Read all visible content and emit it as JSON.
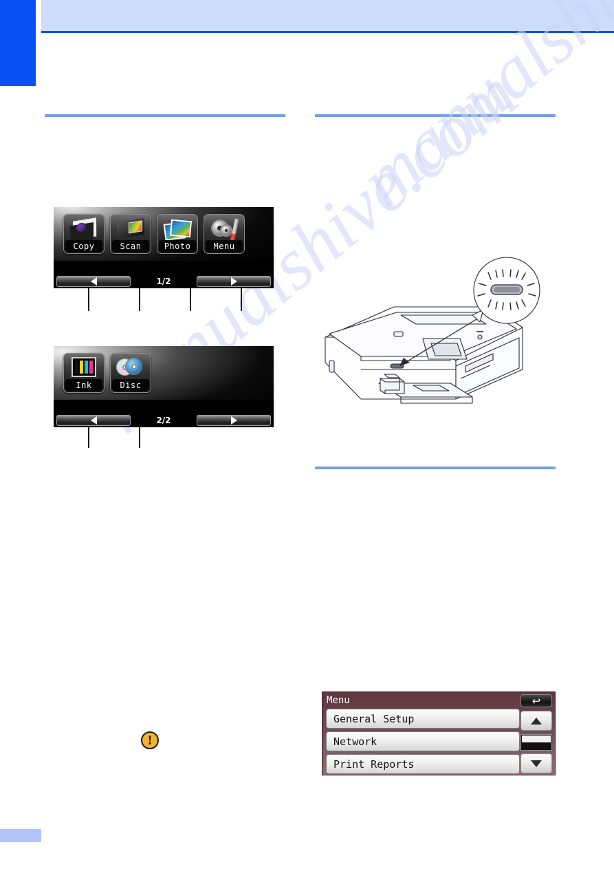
{
  "page": {
    "header_band_color": "#ccdcfa",
    "header_rule_color": "#0b50f5",
    "chapter_tab_color": "#0b50f5",
    "section_rule_color": "#77a0e0",
    "watermark_text": "manualshive.com"
  },
  "lcd_home_1": {
    "page_indicator": "1/2",
    "tiles": [
      {
        "label": "Copy",
        "icon": "copy-icon"
      },
      {
        "label": "Scan",
        "icon": "scan-icon"
      },
      {
        "label": "Photo",
        "icon": "photo-icon"
      },
      {
        "label": "Menu",
        "icon": "menu-gear-icon"
      }
    ],
    "nav": {
      "prev_icon": "left-arrow-icon",
      "next_icon": "right-arrow-icon"
    }
  },
  "lcd_home_2": {
    "page_indicator": "2/2",
    "tiles": [
      {
        "label": "Ink",
        "icon": "ink-cartridge-icon"
      },
      {
        "label": "Disc",
        "icon": "disc-icon"
      }
    ],
    "nav": {
      "prev_icon": "left-arrow-icon",
      "next_icon": "right-arrow-icon"
    }
  },
  "lcd_menu": {
    "title": "Menu",
    "rows": [
      {
        "label": "General Setup"
      },
      {
        "label": "Network"
      },
      {
        "label": "Print Reports"
      }
    ],
    "back_glyph": "↩",
    "scroll_up_icon": "up-arrow-icon",
    "scroll_down_icon": "down-arrow-icon",
    "background_color": "#6d4650"
  },
  "illustration": {
    "name": "printer-with-usb-media-slot",
    "callout": "usb-slot-closeup",
    "callout_item": "media-slot-indicator"
  },
  "notice": {
    "icon": "warning-exclamation-icon",
    "icon_color": "#f5b22d"
  }
}
